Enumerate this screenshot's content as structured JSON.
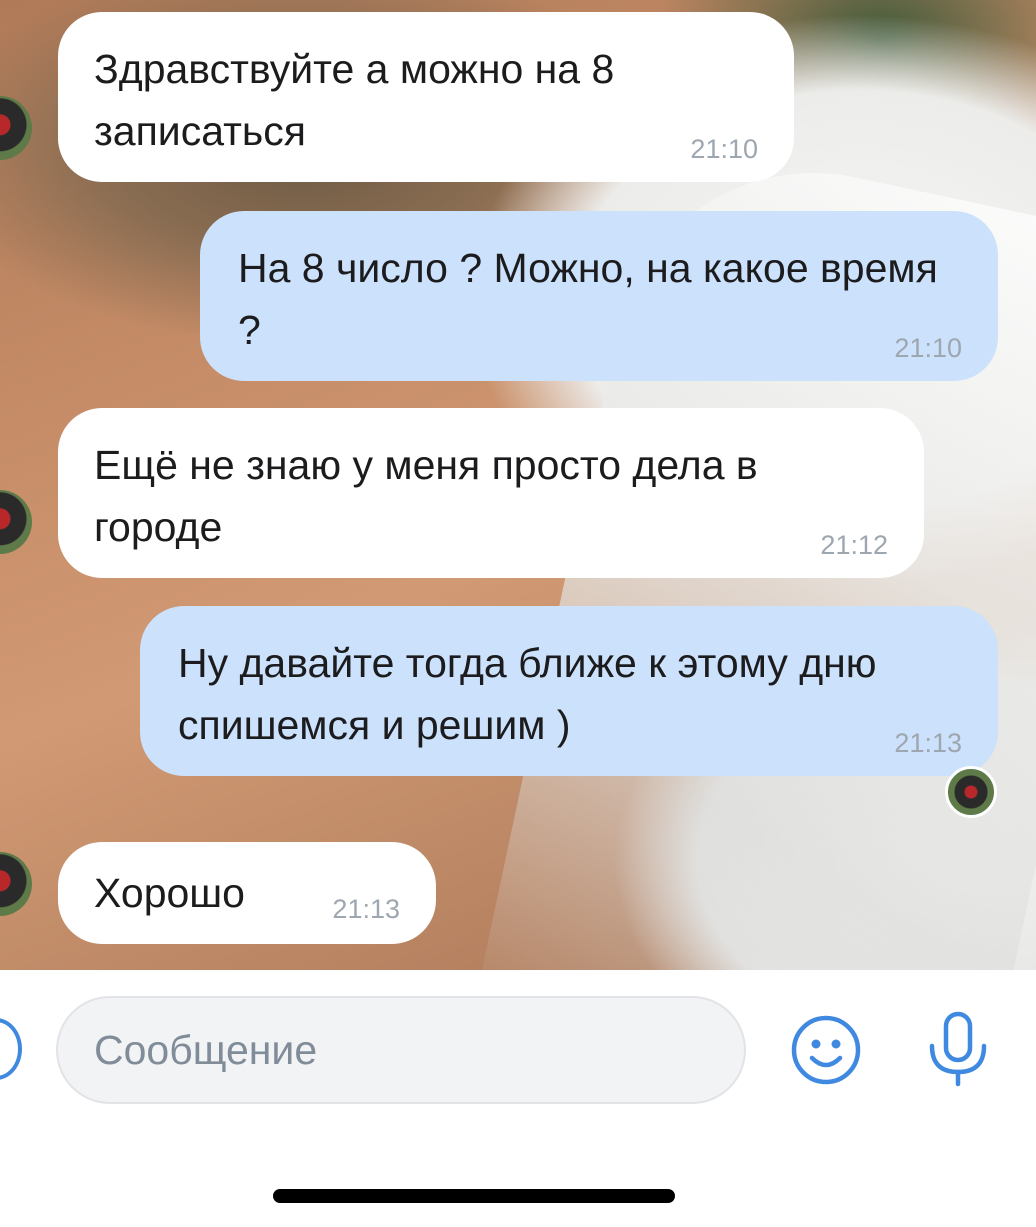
{
  "messages": [
    {
      "direction": "in",
      "text": "Здравствуйте а можно на 8 записаться",
      "time": "21:10"
    },
    {
      "direction": "out",
      "text": "На 8 число ? Можно, на какое время ?",
      "time": "21:10"
    },
    {
      "direction": "in",
      "text": "Ещё не знаю у меня просто дела в городе",
      "time": "21:12"
    },
    {
      "direction": "out",
      "text": "Ну давайте тогда ближе к этому дню спишемся и решим )",
      "time": "21:13"
    },
    {
      "direction": "in",
      "text": "Хорошо",
      "time": "21:13"
    }
  ],
  "composer": {
    "placeholder": "Сообщение"
  },
  "icons": {
    "attach": "attach-icon",
    "emoji": "smile-icon",
    "voice": "microphone-icon"
  },
  "colors": {
    "incoming_bubble": "#ffffff",
    "outgoing_bubble": "#cce1fb",
    "accent": "#3f8ae0",
    "timestamp": "#9ea6b0"
  }
}
